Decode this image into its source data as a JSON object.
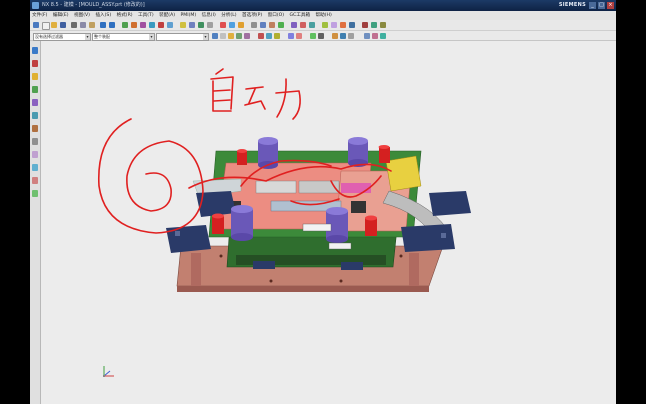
{
  "window": {
    "title": "NX 8.5 - 建模 - [MOULD_ASSY.prt (修改的)]",
    "brand": "SIEMENS",
    "controls": [
      "_",
      "□",
      "×"
    ]
  },
  "menu": {
    "items": [
      "文件(F)",
      "编辑(E)",
      "视图(V)",
      "插入(S)",
      "格式(R)",
      "工具(T)",
      "装配(A)",
      "PMI(M)",
      "信息(I)",
      "分析(L)",
      "首选项(P)",
      "窗口(O)",
      "GC工具箱",
      "帮助(H)"
    ]
  },
  "toolbar2": {
    "filter_value": "没有选择过滤器",
    "assembly_value": "整个装配",
    "third_value": ""
  },
  "annotation": {
    "handwritten_text": "自动",
    "stroke_color": "#e02020"
  },
  "colors": {
    "titlebar": "#1c3a66",
    "viewport": "#ececec",
    "mold_base": "#c28070",
    "plate_green": "#3c8a3a",
    "plate_pink": "#ec8d82",
    "cylinder_purple": "#7a68c8",
    "cylinder_red": "#d42020",
    "clamp_navy": "#2a3a68",
    "insert_yellow": "#e8d040"
  },
  "icons": {
    "app_icon": "nx-app-icon",
    "triad": "wcs-triad-icon"
  }
}
